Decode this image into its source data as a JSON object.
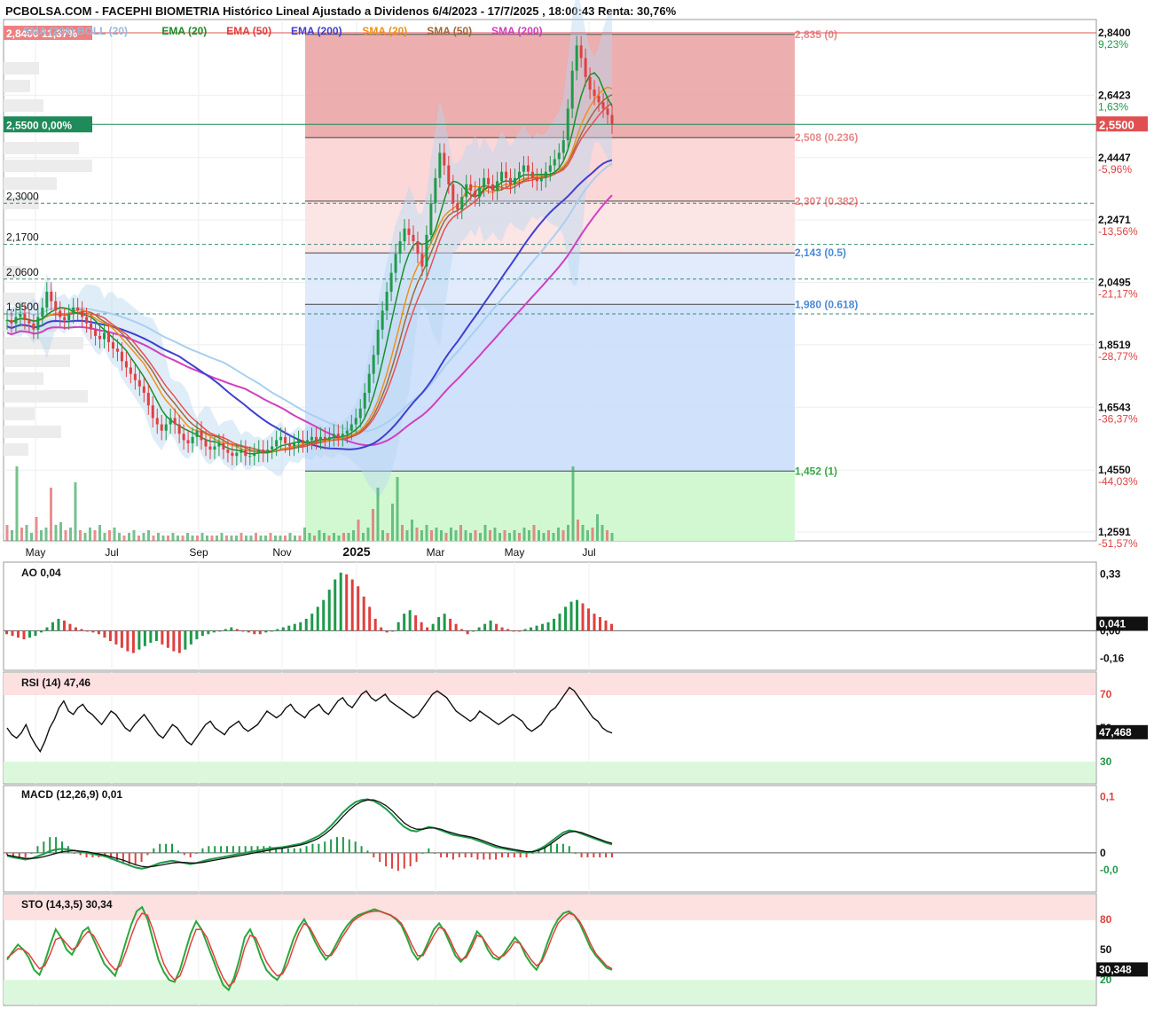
{
  "title": "PCBOLSA.COM - FACEPHI BIOMETRIA Histórico Lineal Ajustado a Dividenos 6/4/2023 - 17/7/2025 , 18:00:43 Renta: 30,76%",
  "colors": {
    "up": "#1f9a4a",
    "down": "#e04040",
    "ema20": "#1a8f2a",
    "ema50": "#e85050",
    "ema200": "#4040d0",
    "sma20": "#f0901a",
    "sma50": "#a06a3a",
    "sma200": "#d040c0",
    "boll": "#a8d0f0",
    "fib_red": "#f2a8a8",
    "fib_blue": "#a8c8f8",
    "fib_green": "#c8f4c8"
  },
  "legend": [
    {
      "label": "SMA (200) BOLL (20)",
      "color": "#9ab8d8"
    },
    {
      "label": "EMA (20)",
      "color": "#1a8f2a"
    },
    {
      "label": "EMA (50)",
      "color": "#e04040"
    },
    {
      "label": "EMA (200)",
      "color": "#4040d0"
    },
    {
      "label": "SMA (20)",
      "color": "#f0901a"
    },
    {
      "label": "SMA (50)",
      "color": "#a06a3a"
    },
    {
      "label": "SMA (200)",
      "color": "#d040c0"
    }
  ],
  "chart_data": [
    {
      "type": "candlestick",
      "price_range": [
        1.2591,
        2.84
      ],
      "y_ticks": [
        {
          "value": 2.84,
          "label": "2,8400",
          "pct": "9,23%",
          "pct_color": "#1f9a4a"
        },
        {
          "value": 2.6423,
          "label": "2,6423",
          "pct": "1,63%",
          "pct_color": "#1f9a4a"
        },
        {
          "value": 2.4447,
          "label": "2,4447",
          "pct": "-5,96%",
          "pct_color": "#e04040"
        },
        {
          "value": 2.2471,
          "label": "2,2471",
          "pct": "-13,56%",
          "pct_color": "#e04040"
        },
        {
          "value": 2.0495,
          "label": "2,0495",
          "pct": "-21,17%",
          "pct_color": "#e04040"
        },
        {
          "value": 1.8519,
          "label": "1,8519",
          "pct": "-28,77%",
          "pct_color": "#e04040"
        },
        {
          "value": 1.6543,
          "label": "1,6543",
          "pct": "-36,37%",
          "pct_color": "#e04040"
        },
        {
          "value": 1.455,
          "label": "1,4550",
          "pct": "-44,03%",
          "pct_color": "#e04040"
        },
        {
          "value": 1.2591,
          "label": "1,2591",
          "pct": "-51,57%",
          "pct_color": "#e04040"
        }
      ],
      "x_ticks": [
        "May",
        "Jul",
        "Sep",
        "Nov",
        "2025",
        "Mar",
        "May",
        "Jul"
      ],
      "last_price": {
        "value": 2.55,
        "label": "2,5500"
      },
      "high_marker": {
        "value": 2.84,
        "label": "2,8400 11,37%"
      },
      "ref_marker": {
        "value": 2.55,
        "label": "2,5500 0,00%"
      },
      "support_levels": [
        {
          "value": 2.3,
          "label": "2,3000"
        },
        {
          "value": 2.17,
          "label": "2,1700"
        },
        {
          "value": 2.06,
          "label": "2,0600"
        },
        {
          "value": 1.95,
          "label": "1,9500"
        }
      ],
      "fibonacci": [
        {
          "value": 2.835,
          "label": "2,835 (0)"
        },
        {
          "value": 2.508,
          "label": "2,508 (0.236)"
        },
        {
          "value": 2.307,
          "label": "2,307 (0.382)"
        },
        {
          "value": 2.143,
          "label": "2,143 (0.5)"
        },
        {
          "value": 1.98,
          "label": "1,980 (0.618)"
        },
        {
          "value": 1.452,
          "label": "1,452 (1)"
        }
      ],
      "close_series": [
        1.93,
        1.92,
        1.94,
        1.95,
        1.93,
        1.92,
        1.9,
        1.94,
        1.97,
        2.02,
        1.99,
        1.96,
        1.94,
        1.93,
        1.95,
        1.97,
        1.96,
        1.94,
        1.92,
        1.9,
        1.88,
        1.87,
        1.89,
        1.86,
        1.84,
        1.83,
        1.8,
        1.78,
        1.76,
        1.74,
        1.72,
        1.7,
        1.66,
        1.62,
        1.6,
        1.58,
        1.6,
        1.62,
        1.6,
        1.57,
        1.55,
        1.54,
        1.56,
        1.58,
        1.55,
        1.53,
        1.52,
        1.53,
        1.54,
        1.52,
        1.51,
        1.5,
        1.51,
        1.52,
        1.5,
        1.5,
        1.51,
        1.52,
        1.51,
        1.52,
        1.53,
        1.55,
        1.56,
        1.54,
        1.53,
        1.54,
        1.55,
        1.54,
        1.55,
        1.56,
        1.55,
        1.56,
        1.55,
        1.56,
        1.57,
        1.56,
        1.57,
        1.58,
        1.6,
        1.62,
        1.65,
        1.7,
        1.76,
        1.82,
        1.9,
        1.96,
        2.02,
        2.08,
        2.14,
        2.18,
        2.22,
        2.2,
        2.18,
        2.14,
        2.1,
        2.2,
        2.3,
        2.38,
        2.46,
        2.42,
        2.36,
        2.3,
        2.28,
        2.32,
        2.36,
        2.34,
        2.32,
        2.35,
        2.38,
        2.36,
        2.34,
        2.37,
        2.4,
        2.38,
        2.36,
        2.38,
        2.4,
        2.42,
        2.4,
        2.38,
        2.37,
        2.38,
        2.4,
        2.42,
        2.44,
        2.46,
        2.5,
        2.6,
        2.72,
        2.8,
        2.76,
        2.7,
        2.66,
        2.64,
        2.62,
        2.6,
        2.58,
        2.55
      ],
      "volume_series": [
        6,
        4,
        28,
        5,
        6,
        3,
        9,
        4,
        5,
        20,
        6,
        7,
        4,
        5,
        22,
        4,
        3,
        5,
        4,
        6,
        3,
        4,
        5,
        3,
        2,
        3,
        4,
        2,
        3,
        4,
        2,
        3,
        2,
        2,
        3,
        2,
        2,
        3,
        2,
        2,
        3,
        2,
        2,
        2,
        3,
        2,
        2,
        2,
        3,
        2,
        2,
        3,
        2,
        2,
        3,
        2,
        2,
        2,
        3,
        2,
        2,
        5,
        3,
        2,
        4,
        3,
        2,
        3,
        2,
        3,
        3,
        4,
        8,
        3,
        5,
        12,
        20,
        4,
        3,
        14,
        24,
        6,
        4,
        8,
        5,
        4,
        6,
        4,
        5,
        4,
        3,
        5,
        4,
        6,
        4,
        3,
        4,
        3,
        6,
        4,
        5,
        3,
        4,
        3,
        4,
        3,
        5,
        4,
        6,
        4,
        3,
        4,
        3,
        5,
        4,
        6,
        28,
        8,
        6,
        4,
        5,
        10,
        6,
        4,
        3
      ]
    },
    {
      "type": "bar",
      "name": "AO",
      "title": "AO  0,04",
      "y_ticks": [
        {
          "value": 0.33,
          "label": "0,33"
        },
        {
          "value": 0,
          "label": "0,00"
        },
        {
          "value": -0.16,
          "label": "-0,16"
        }
      ],
      "y_range": [
        -0.2,
        0.37
      ],
      "last": {
        "value": 0.041,
        "label": "0,041"
      },
      "values": [
        -0.02,
        -0.03,
        -0.04,
        -0.05,
        -0.04,
        -0.03,
        -0.01,
        0.02,
        0.05,
        0.07,
        0.06,
        0.04,
        0.02,
        0.01,
        0.0,
        -0.01,
        -0.02,
        -0.04,
        -0.06,
        -0.08,
        -0.1,
        -0.12,
        -0.13,
        -0.11,
        -0.09,
        -0.07,
        -0.06,
        -0.08,
        -0.1,
        -0.12,
        -0.13,
        -0.11,
        -0.08,
        -0.05,
        -0.03,
        -0.02,
        -0.01,
        0.0,
        0.01,
        0.02,
        0.01,
        0.0,
        -0.01,
        -0.02,
        -0.02,
        -0.01,
        0.0,
        0.01,
        0.02,
        0.03,
        0.04,
        0.05,
        0.07,
        0.1,
        0.14,
        0.18,
        0.24,
        0.3,
        0.34,
        0.33,
        0.3,
        0.26,
        0.2,
        0.14,
        0.07,
        0.02,
        -0.01,
        0.0,
        0.05,
        0.1,
        0.12,
        0.09,
        0.05,
        0.02,
        0.04,
        0.08,
        0.1,
        0.07,
        0.04,
        0.01,
        -0.02,
        0.0,
        0.02,
        0.04,
        0.06,
        0.04,
        0.02,
        0.01,
        0.0,
        0.0,
        0.01,
        0.02,
        0.03,
        0.04,
        0.05,
        0.07,
        0.1,
        0.14,
        0.17,
        0.18,
        0.16,
        0.13,
        0.1,
        0.08,
        0.06,
        0.04
      ]
    },
    {
      "type": "line",
      "name": "RSI",
      "title": "RSI (14)  47,46",
      "y_ticks": [
        {
          "value": 70,
          "label": "70",
          "color": "#e04040"
        },
        {
          "value": 50,
          "label": "50",
          "color": "#111"
        },
        {
          "value": 30,
          "label": "30",
          "color": "#1f9a4a"
        }
      ],
      "y_range": [
        20,
        80
      ],
      "last": {
        "value": 47.468,
        "label": "47,468"
      },
      "values": [
        50,
        46,
        44,
        47,
        52,
        45,
        40,
        36,
        42,
        50,
        55,
        62,
        66,
        60,
        58,
        62,
        64,
        60,
        58,
        55,
        52,
        56,
        60,
        58,
        54,
        50,
        48,
        52,
        55,
        58,
        54,
        50,
        46,
        44,
        48,
        52,
        50,
        46,
        42,
        40,
        44,
        48,
        52,
        54,
        50,
        48,
        46,
        50,
        52,
        54,
        50,
        48,
        50,
        52,
        56,
        60,
        58,
        56,
        58,
        62,
        64,
        60,
        58,
        56,
        60,
        62,
        64,
        60,
        58,
        62,
        66,
        68,
        64,
        62,
        66,
        70,
        72,
        68,
        66,
        68,
        70,
        66,
        64,
        62,
        60,
        58,
        56,
        58,
        62,
        66,
        70,
        72,
        70,
        68,
        64,
        60,
        58,
        56,
        54,
        56,
        60,
        58,
        56,
        54,
        52,
        54,
        56,
        58,
        56,
        54,
        50,
        48,
        50,
        52,
        56,
        60,
        62,
        66,
        70,
        74,
        72,
        68,
        64,
        60,
        56,
        54,
        50,
        48,
        47
      ]
    },
    {
      "type": "line",
      "name": "MACD",
      "title": "MACD (12,26,9)  0,01",
      "y_ticks": [
        {
          "value": 0.1,
          "label": "0,1",
          "color": "#e04040"
        },
        {
          "value": 0,
          "label": "0",
          "color": "#111"
        },
        {
          "value": -0.03,
          "label": "-0,0",
          "color": "#1f9a4a"
        }
      ],
      "y_range": [
        -0.06,
        0.11
      ],
      "macd": [
        -0.005,
        -0.008,
        -0.01,
        -0.012,
        -0.01,
        -0.006,
        -0.002,
        0.003,
        0.006,
        0.007,
        0.006,
        0.004,
        0.002,
        0.0,
        -0.002,
        -0.004,
        -0.006,
        -0.01,
        -0.014,
        -0.018,
        -0.022,
        -0.026,
        -0.028,
        -0.026,
        -0.022,
        -0.018,
        -0.016,
        -0.014,
        -0.016,
        -0.018,
        -0.02,
        -0.018,
        -0.015,
        -0.012,
        -0.01,
        -0.008,
        -0.006,
        -0.004,
        -0.002,
        0.0,
        0.002,
        0.004,
        0.006,
        0.008,
        0.009,
        0.01,
        0.012,
        0.014,
        0.016,
        0.02,
        0.025,
        0.03,
        0.038,
        0.048,
        0.06,
        0.072,
        0.082,
        0.09,
        0.094,
        0.095,
        0.092,
        0.086,
        0.078,
        0.068,
        0.056,
        0.046,
        0.04,
        0.038,
        0.042,
        0.046,
        0.044,
        0.04,
        0.036,
        0.032,
        0.03,
        0.028,
        0.026,
        0.022,
        0.018,
        0.014,
        0.01,
        0.008,
        0.006,
        0.004,
        0.002,
        0.0,
        0.002,
        0.006,
        0.012,
        0.02,
        0.028,
        0.036,
        0.04,
        0.038,
        0.034,
        0.03,
        0.026,
        0.022,
        0.018,
        0.015
      ],
      "signal": [
        -0.004,
        -0.006,
        -0.008,
        -0.01,
        -0.01,
        -0.009,
        -0.007,
        -0.004,
        -0.001,
        0.002,
        0.003,
        0.004,
        0.003,
        0.002,
        0.0,
        -0.002,
        -0.004,
        -0.007,
        -0.01,
        -0.013,
        -0.017,
        -0.021,
        -0.024,
        -0.025,
        -0.024,
        -0.022,
        -0.02,
        -0.018,
        -0.017,
        -0.017,
        -0.018,
        -0.018,
        -0.017,
        -0.015,
        -0.013,
        -0.011,
        -0.009,
        -0.007,
        -0.005,
        -0.003,
        -0.001,
        0.001,
        0.003,
        0.005,
        0.007,
        0.008,
        0.01,
        0.012,
        0.014,
        0.017,
        0.021,
        0.026,
        0.033,
        0.042,
        0.053,
        0.065,
        0.076,
        0.085,
        0.091,
        0.094,
        0.094,
        0.09,
        0.084,
        0.075,
        0.064,
        0.053,
        0.046,
        0.042,
        0.042,
        0.044,
        0.044,
        0.042,
        0.038,
        0.035,
        0.032,
        0.03,
        0.028,
        0.025,
        0.021,
        0.017,
        0.013,
        0.01,
        0.008,
        0.006,
        0.004,
        0.002,
        0.002,
        0.004,
        0.009,
        0.016,
        0.024,
        0.032,
        0.037,
        0.038,
        0.036,
        0.032,
        0.028,
        0.024,
        0.02,
        0.017
      ]
    },
    {
      "type": "line",
      "name": "STO",
      "title": "STO (14,3,5)  30,34",
      "y_ticks": [
        {
          "value": 80,
          "label": "80",
          "color": "#e04040"
        },
        {
          "value": 50,
          "label": "50",
          "color": "#111"
        },
        {
          "value": 20,
          "label": "20",
          "color": "#1f9a4a"
        }
      ],
      "y_range": [
        0,
        100
      ],
      "last": {
        "value": 30.348,
        "label": "30,348"
      },
      "k": [
        40,
        48,
        55,
        50,
        42,
        30,
        25,
        38,
        55,
        70,
        62,
        50,
        45,
        55,
        68,
        72,
        60,
        48,
        36,
        30,
        24,
        40,
        58,
        75,
        88,
        92,
        80,
        60,
        40,
        28,
        20,
        18,
        30,
        48,
        66,
        78,
        70,
        56,
        42,
        28,
        15,
        10,
        22,
        40,
        62,
        70,
        58,
        42,
        30,
        24,
        20,
        28,
        44,
        60,
        72,
        80,
        70,
        58,
        48,
        40,
        46,
        56,
        66,
        74,
        80,
        84,
        86,
        88,
        90,
        88,
        86,
        84,
        80,
        74,
        62,
        48,
        40,
        46,
        58,
        70,
        76,
        68,
        56,
        44,
        38,
        44,
        56,
        68,
        62,
        50,
        42,
        40,
        46,
        54,
        62,
        56,
        44,
        36,
        30,
        40,
        56,
        70,
        80,
        86,
        88,
        84,
        76,
        64,
        52,
        44,
        38,
        32,
        30
      ],
      "d": [
        42,
        46,
        51,
        50,
        46,
        38,
        31,
        34,
        46,
        60,
        62,
        56,
        50,
        53,
        62,
        68,
        64,
        54,
        44,
        36,
        30,
        34,
        48,
        64,
        78,
        86,
        84,
        70,
        52,
        36,
        26,
        20,
        24,
        38,
        56,
        70,
        70,
        62,
        48,
        34,
        22,
        14,
        18,
        32,
        52,
        64,
        62,
        50,
        38,
        30,
        24,
        26,
        36,
        52,
        66,
        76,
        72,
        62,
        52,
        44,
        44,
        52,
        62,
        70,
        78,
        82,
        85,
        87,
        88,
        88,
        86,
        84,
        81,
        76,
        66,
        54,
        44,
        44,
        54,
        64,
        72,
        70,
        60,
        48,
        40,
        42,
        52,
        64,
        62,
        54,
        46,
        42,
        44,
        50,
        58,
        56,
        48,
        40,
        34,
        38,
        50,
        64,
        76,
        82,
        86,
        84,
        78,
        68,
        56,
        46,
        40,
        34,
        31
      ]
    }
  ]
}
